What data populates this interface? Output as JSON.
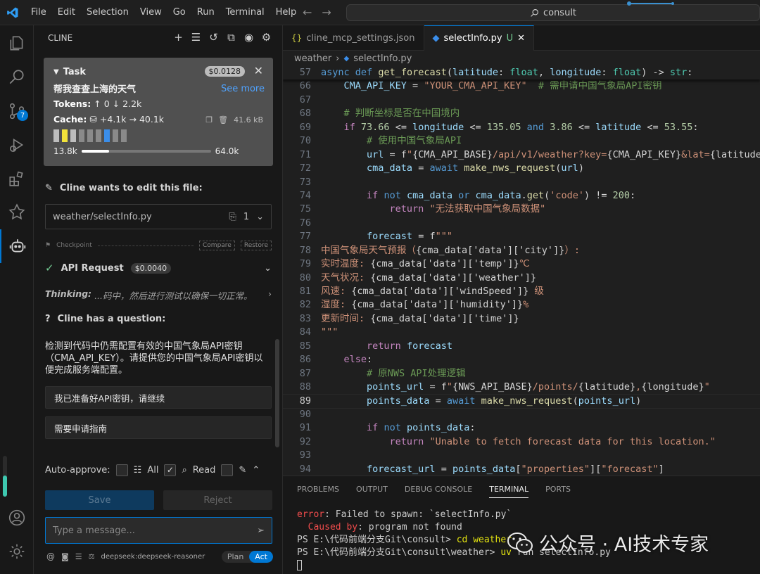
{
  "menu": [
    "File",
    "Edit",
    "Selection",
    "View",
    "Go",
    "Run",
    "Terminal",
    "Help"
  ],
  "search": {
    "text": "consult"
  },
  "activity": {
    "scm_badge": "7"
  },
  "sidebar": {
    "title": "CLINE",
    "task": {
      "label": "Task",
      "price": "$0.0128",
      "question": "帮我查查上海的天气",
      "see_more": "See more",
      "tokens_label": "Tokens:",
      "tokens_up": "0",
      "tokens_down": "2.2k",
      "cache_label": "Cache:",
      "cache_write": "+4.1k",
      "cache_read": "40.1k",
      "size": "41.6 kB",
      "ctx_used": "13.8k",
      "ctx_total": "64.0k",
      "ctx_fraction": 0.216
    },
    "edit_title": "Cline wants to edit this file:",
    "edit_file": "weather/selectInfo.py",
    "edit_count": "1",
    "checkpoint": {
      "label": "Checkpoint",
      "compare": "Compare",
      "restore": "Restore"
    },
    "api": {
      "label": "API Request",
      "price": "$0.0040"
    },
    "thinking": {
      "label": "Thinking:",
      "text": "...码中，然后进行测试以确保一切正常。"
    },
    "question_title": "Cline has a question:",
    "question_text": "检测到代码中仍需配置有效的中国气象局API密钥（CMA_API_KEY）。请提供您的中国气象局API密钥以便完成服务端配置。",
    "options": [
      "我已准备好API密钥，请继续",
      "需要申请指南"
    ],
    "auto_approve": {
      "label": "Auto-approve:",
      "all": "All",
      "read": "Read"
    },
    "save": "Save",
    "reject": "Reject",
    "input_placeholder": "Type a message...",
    "model": "deepseek:deepseek-reasoner",
    "plan": "Plan",
    "act": "Act"
  },
  "editor": {
    "tabs": [
      {
        "label": "cline_mcp_settings.json"
      },
      {
        "label": "selectInfo.py",
        "status": "U"
      }
    ],
    "breadcrumb": [
      "weather",
      "selectInfo.py"
    ]
  },
  "code_lines": [
    {
      "n": "57",
      "t": "async def get_forecast(latitude: float, longitude: float) -> str:"
    },
    {
      "n": "66",
      "t": "    CMA_API_KEY = \"YOUR_CMA_API_KEY\"  # 需申请中国气象局API密钥"
    },
    {
      "n": "67",
      "t": ""
    },
    {
      "n": "68",
      "t": "    # 判断坐标是否在中国境内"
    },
    {
      "n": "69",
      "t": "    if 73.66 <= longitude <= 135.05 and 3.86 <= latitude <= 53.55:"
    },
    {
      "n": "70",
      "t": "        # 使用中国气象局API"
    },
    {
      "n": "71",
      "t": "        url = f\"{CMA_API_BASE}/api/v1/weather?key={CMA_API_KEY}&lat={latitude}"
    },
    {
      "n": "72",
      "t": "        cma_data = await make_nws_request(url)"
    },
    {
      "n": "73",
      "t": ""
    },
    {
      "n": "74",
      "t": "        if not cma_data or cma_data.get('code') != 200:"
    },
    {
      "n": "75",
      "t": "            return \"无法获取中国气象局数据\""
    },
    {
      "n": "76",
      "t": ""
    },
    {
      "n": "77",
      "t": "        forecast = f\"\"\""
    },
    {
      "n": "78",
      "t": "中国气象局天气预报（{cma_data['data']['city']}）:"
    },
    {
      "n": "79",
      "t": "实时温度: {cma_data['data']['temp']}℃"
    },
    {
      "n": "80",
      "t": "天气状况: {cma_data['data']['weather']}"
    },
    {
      "n": "81",
      "t": "风速: {cma_data['data']['windSpeed']} 级"
    },
    {
      "n": "82",
      "t": "湿度: {cma_data['data']['humidity']}%"
    },
    {
      "n": "83",
      "t": "更新时间: {cma_data['data']['time']}"
    },
    {
      "n": "84",
      "t": "\"\"\""
    },
    {
      "n": "85",
      "t": "        return forecast"
    },
    {
      "n": "86",
      "t": "    else:"
    },
    {
      "n": "87",
      "t": "        # 原NWS API处理逻辑"
    },
    {
      "n": "88",
      "t": "        points_url = f\"{NWS_API_BASE}/points/{latitude},{longitude}\""
    },
    {
      "n": "89",
      "t": "        points_data = await make_nws_request(points_url)"
    },
    {
      "n": "90",
      "t": ""
    },
    {
      "n": "91",
      "t": "        if not points_data:"
    },
    {
      "n": "92",
      "t": "            return \"Unable to fetch forecast data for this location.\""
    },
    {
      "n": "93",
      "t": ""
    },
    {
      "n": "94",
      "t": "        forecast_url = points_data[\"properties\"][\"forecast\"]"
    }
  ],
  "panel": {
    "tabs": [
      "PROBLEMS",
      "OUTPUT",
      "DEBUG CONSOLE",
      "TERMINAL",
      "PORTS"
    ],
    "active_tab": "TERMINAL",
    "terminal": {
      "err_label": "error",
      "err_text": ": Failed to spawn: `selectInfo.py`",
      "caused_label": "  Caused by",
      "caused_text": ": program not found",
      "ps1_prompt": "PS E:\\代码前端分支Git\\consult> ",
      "ps1_cmd": "cd weather",
      "ps2_prompt": "PS E:\\代码前端分支Git\\consult\\weather> ",
      "ps2_cmd_a": "uv",
      "ps2_cmd_b": " run selectInfo.py"
    }
  },
  "watermark": "公众号 · AI技术专家"
}
